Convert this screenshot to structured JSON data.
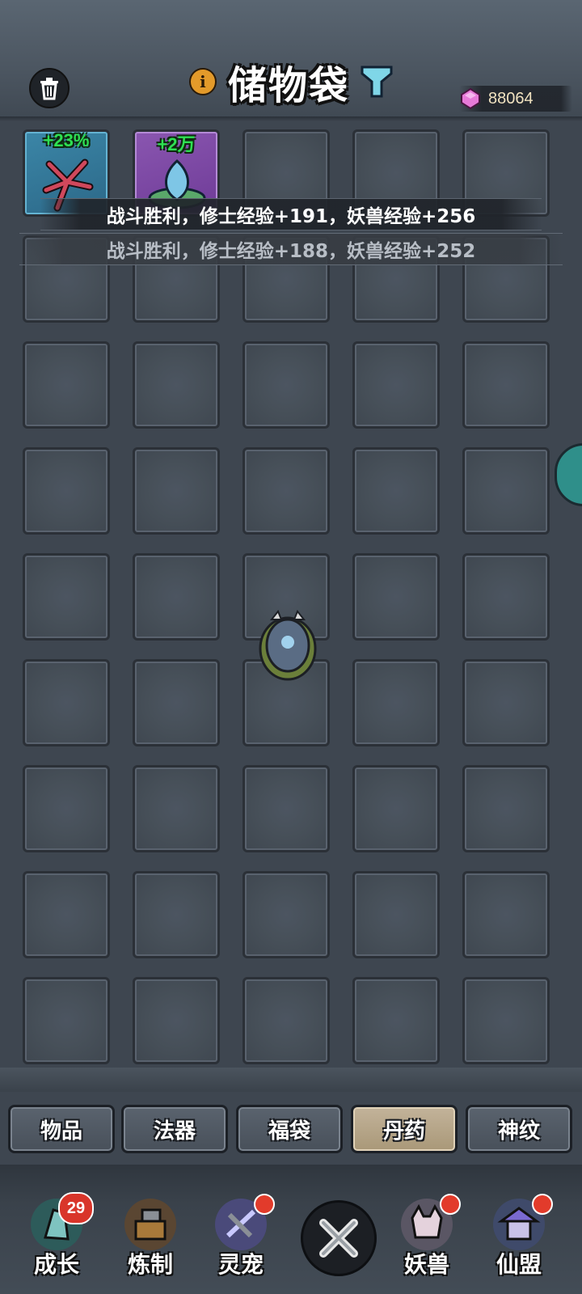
{
  "header": {
    "title": "储物袋",
    "info_icon": "info-icon",
    "filter_icon": "filter-icon",
    "trash_icon": "trash-icon",
    "currency": {
      "icon": "pink-gem-icon",
      "value": "88064"
    }
  },
  "inventory": {
    "items": [
      {
        "badge": "+23%",
        "icon": "red-starflower-icon",
        "rarity_color": "#3b86a7"
      },
      {
        "badge": "+2万",
        "icon": "blue-lotus-icon",
        "rarity_color": "#8a56b0"
      }
    ]
  },
  "toasts": [
    "战斗胜利，修士经验+191，妖兽经验+256",
    "战斗胜利，修士经验+188，妖兽经验+252"
  ],
  "categories": [
    {
      "label": "物品",
      "active": false
    },
    {
      "label": "法器",
      "active": false
    },
    {
      "label": "福袋",
      "active": false
    },
    {
      "label": "丹药",
      "active": true
    },
    {
      "label": "神纹",
      "active": false
    }
  ],
  "bottom_nav": [
    {
      "label": "成长",
      "icon": "growth-icon",
      "badge": "29"
    },
    {
      "label": "炼制",
      "icon": "forge-icon",
      "dot": false
    },
    {
      "label": "灵宠",
      "icon": "spirit-pet-icon",
      "dot": true
    },
    {
      "label": "妖兽",
      "icon": "demon-beast-icon",
      "dot": true
    },
    {
      "label": "仙盟",
      "icon": "immortal-alliance-icon",
      "dot": true
    }
  ],
  "close_icon": "close-x-icon"
}
